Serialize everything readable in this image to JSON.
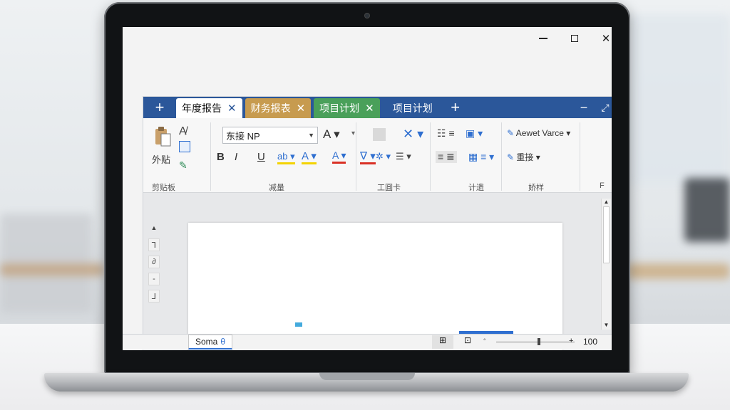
{
  "window": {
    "minimize_icon": "minimize-icon",
    "maximize_icon": "maximize-icon",
    "close_icon": "close-icon"
  },
  "tabs": [
    {
      "label": "年度报告",
      "close": "✕"
    },
    {
      "label": "财务报表",
      "close": "✕"
    },
    {
      "label": "项目计划",
      "close": "✕"
    },
    {
      "label": "项目计划"
    }
  ],
  "tabbar": {
    "new_tab": "+",
    "add_tab": "+",
    "minimize": "−",
    "restore": "⤢"
  },
  "ribbon": {
    "paste_label": "外贴",
    "font_name": "东接 NP",
    "bold": "B",
    "italic": "I",
    "underline": "U",
    "style_preview": "Aewet Varce",
    "replace_label": "重接",
    "groups": {
      "clipboard": "剪贴板",
      "font": "减量",
      "tools": "工圓卡",
      "paragraph": "计遗",
      "styles": "娇样",
      "more": "F"
    }
  },
  "colors": {
    "tabbar": "#2b579a",
    "tab_gold": "#c79b4f",
    "tab_green": "#4aa05a",
    "accent_blue": "#2f6fd0"
  },
  "statusbar": {
    "page_label": "Soma",
    "zoom": "100"
  }
}
